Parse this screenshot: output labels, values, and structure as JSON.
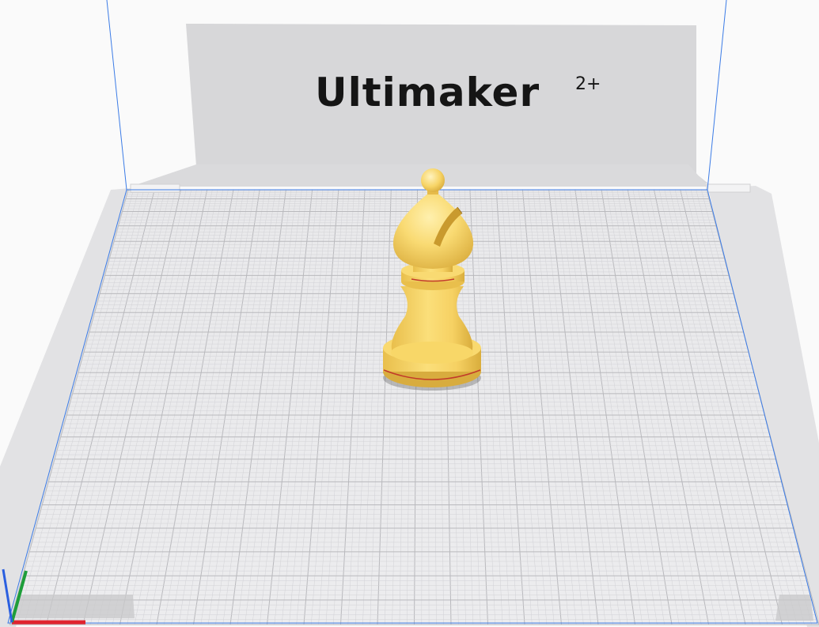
{
  "window": {
    "type": "3d-viewport",
    "background_color": "#fafafa"
  },
  "printer": {
    "brand": "Ultimaker",
    "model": "2+"
  },
  "build_plate": {
    "plate_color": "#e6e6e8",
    "grid_color": "#b9b9bd",
    "fine_grid_color": "#d2d2d6",
    "volume_outline_color": "#3b7be6",
    "backplate_color": "#d6d6d8"
  },
  "model": {
    "object": "chess-bishop",
    "color": "#f7d466",
    "shade_color": "#d9ad3c",
    "highlight_color": "#fff1b0",
    "edge_color": "#c23a2a"
  },
  "axes": {
    "x_color": "#e0242e",
    "y_color": "#1e9e3a",
    "z_color": "#2a5fe0"
  }
}
